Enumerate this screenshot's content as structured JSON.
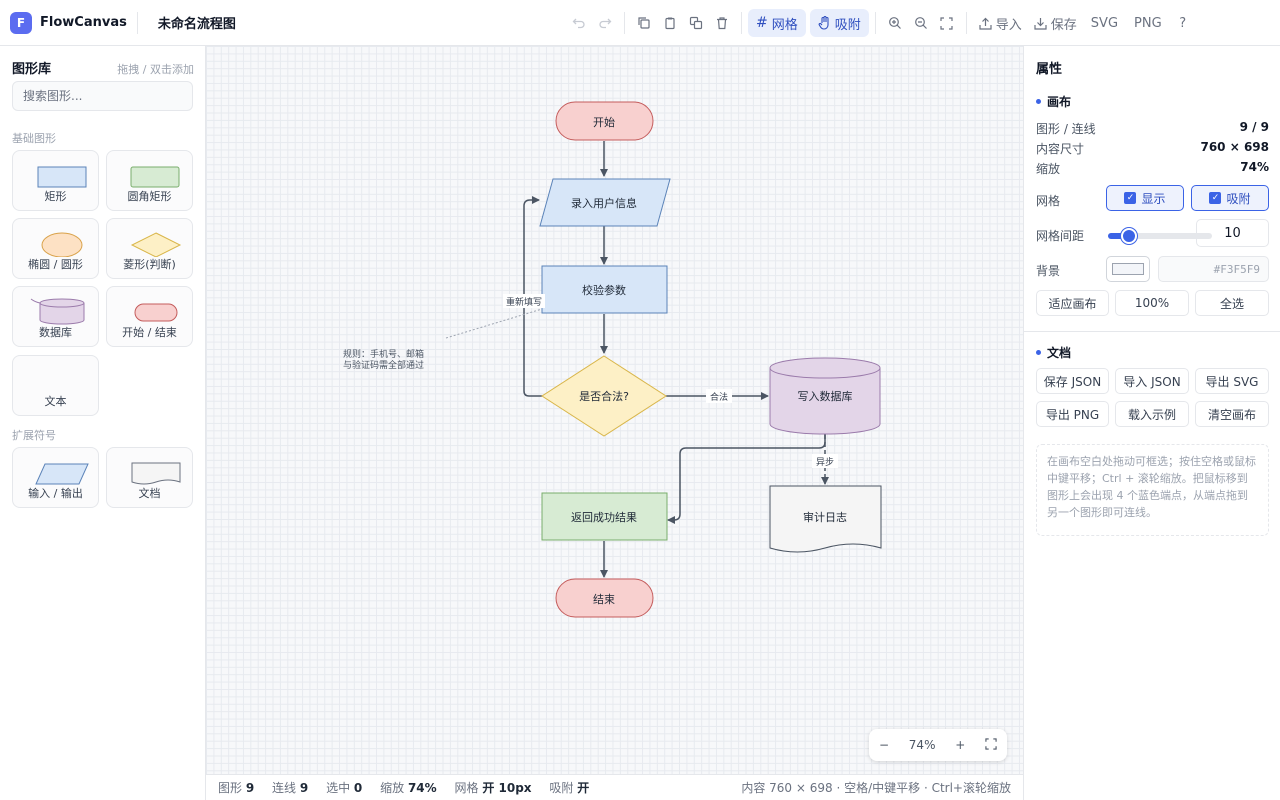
{
  "header": {
    "logo_letter": "F",
    "app_name": "FlowCanvas",
    "doc_title": "未命名流程图",
    "grid_label": "网格",
    "snap_label": "吸附",
    "import_label": "导入",
    "save_label": "保存",
    "svg_label": "SVG",
    "png_label": "PNG",
    "help_label": "?"
  },
  "library": {
    "title": "图形库",
    "hint": "拖拽 / 双击添加",
    "search_placeholder": "搜索图形...",
    "basic_section": "基础图形",
    "basic_items": [
      "矩形",
      "圆角矩形",
      "椭圆 / 圆形",
      "菱形(判断)",
      "数据库",
      "开始 / 结束",
      "文本"
    ],
    "ext_section": "扩展符号",
    "ext_items": [
      "输入 / 输出",
      "文档"
    ]
  },
  "flow": {
    "nodes": {
      "start": "开始",
      "input": "录入用户信息",
      "validate": "校验参数",
      "decision": "是否合法?",
      "db": "写入数据库",
      "result": "返回成功结果",
      "log": "审计日志",
      "end": "结束"
    },
    "edges": {
      "refill": "重新填写",
      "legal": "合法",
      "async": "异步"
    },
    "note_line1": "规则：手机号、邮箱",
    "note_line2": "与验证码需全部通过"
  },
  "zoom": {
    "minus": "−",
    "value": "74%",
    "plus": "+"
  },
  "status": {
    "shapes_label": "图形",
    "shapes": "9",
    "edges_label": "连线",
    "edges": "9",
    "selected_label": "选中",
    "selected": "0",
    "zoom_label": "缩放",
    "zoom": "74%",
    "grid_label": "网格",
    "grid": "开 10px",
    "snap_label": "吸附",
    "snap": "开",
    "right_text": "内容 760 × 698 · 空格/中键平移 · Ctrl+滚轮缩放"
  },
  "props": {
    "title": "属性",
    "canvas_section": "画布",
    "shapes_edges_label": "图形 / 连线",
    "shapes_edges_value": "9 / 9",
    "content_size_label": "内容尺寸",
    "content_size_value": "760 × 698",
    "zoom_label": "缩放",
    "zoom_value": "74%",
    "grid_label": "网格",
    "grid_show": "显示",
    "grid_snap": "吸附",
    "spacing_label": "网格间距",
    "spacing_value": "10",
    "bg_label": "背景",
    "bg_hex": "#F3F5F9",
    "fit_btn": "适应画布",
    "zoom100_btn": "100%",
    "select_all_btn": "全选",
    "doc_section": "文档",
    "doc_buttons": [
      "保存 JSON",
      "导入 JSON",
      "导出 SVG",
      "导出 PNG",
      "载入示例",
      "清空画布"
    ],
    "help": "在画布空白处拖动可框选；按住空格或鼠标中键平移；Ctrl + 滚轮缩放。把鼠标移到图形上会出现 4 个蓝色端点，从端点拖到另一个图形即可连线。"
  },
  "colors": {
    "accent": "#3b63e6",
    "terminal_fill": "#f8d0cf",
    "process_fill": "#d7e6f8",
    "decision_fill": "#fdf0c6",
    "db_fill": "#e3d5e8",
    "result_fill": "#d7ebd3"
  }
}
